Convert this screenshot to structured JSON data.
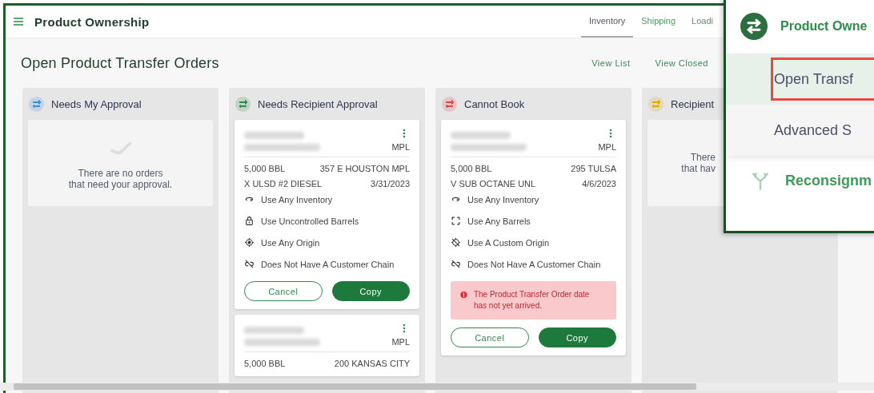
{
  "app": {
    "title": "Product Ownership"
  },
  "nav_tabs": [
    {
      "label": "Inventory",
      "selected": true
    },
    {
      "label": "Shipping",
      "selected": false
    },
    {
      "label": "Loadi",
      "selected": false
    }
  ],
  "page": {
    "title": "Open Product Transfer Orders",
    "links": [
      "View List",
      "View Closed"
    ]
  },
  "columns": [
    {
      "title": "Needs My Approval",
      "color": "#3b8de0",
      "empty_message": "There are no orders\nthat need your approval."
    },
    {
      "title": "Needs Recipient Approval",
      "color": "#2e8b4a",
      "cards": [
        {
          "unit": "MPL",
          "quantity": "5,000 BBL",
          "location": "357 E HOUSTON MPL",
          "product": "X ULSD #2 DIESEL",
          "date": "3/31/2023",
          "features": [
            {
              "kind": "inventory",
              "label": "Use Any Inventory"
            },
            {
              "kind": "lock",
              "label": "Use Uncontrolled Barrels"
            },
            {
              "kind": "target",
              "label": "Use Any Origin"
            },
            {
              "kind": "unlink",
              "label": "Does Not Have A Customer Chain"
            }
          ],
          "buttons": [
            "Cancel",
            "Copy"
          ]
        },
        {
          "unit": "MPL",
          "quantity": "5,000 BBL",
          "location": "200 KANSAS CITY"
        }
      ]
    },
    {
      "title": "Cannot Book",
      "color": "#e04848",
      "cards": [
        {
          "unit": "MPL",
          "quantity": "5,000 BBL",
          "location": "295 TULSA",
          "product": "V SUB OCTANE UNL",
          "date": "4/6/2023",
          "features": [
            {
              "kind": "inventory",
              "label": "Use Any Inventory"
            },
            {
              "kind": "expand",
              "label": "Use Any Barrels"
            },
            {
              "kind": "target-off",
              "label": "Use A Custom Origin"
            },
            {
              "kind": "unlink",
              "label": "Does Not Have A Customer Chain"
            }
          ],
          "alert": "The Product Transfer Order date has not yet arrived.",
          "buttons": [
            "Cancel",
            "Copy"
          ]
        }
      ]
    },
    {
      "title": "Recipient",
      "color": "#e0a800",
      "empty_message": "There\nthat hav"
    }
  ],
  "menu": {
    "title": "Product Owne",
    "items": [
      {
        "label": "Open Transf",
        "selected": true
      },
      {
        "label": "Advanced S",
        "selected": false
      }
    ],
    "next_section": "Reconsignm"
  }
}
